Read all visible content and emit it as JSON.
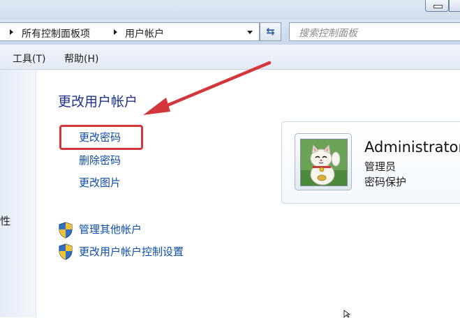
{
  "window": {
    "minimize_icon": "minimize-icon",
    "maximize_icon": "maximize-icon"
  },
  "address_bar": {
    "breadcrumbs": [
      "所有控制面板项",
      "用户帐户"
    ],
    "separator_icon": "chevron-right-icon",
    "dropdown_icon": "chevron-down-icon",
    "refresh_icon": "refresh-icon"
  },
  "search": {
    "placeholder": "搜索控制面板",
    "icon": "search-icon"
  },
  "menu": {
    "items": [
      "工具(T)",
      "帮助(H)"
    ]
  },
  "sidebar": {
    "partial_text": "性"
  },
  "main": {
    "title": "更改用户帐户",
    "tasks": [
      "更改密码",
      "删除密码",
      "更改图片"
    ],
    "admin_tasks": [
      "管理其他帐户",
      "更改用户帐户控制设置"
    ],
    "admin_task_icon": "shield-icon"
  },
  "account": {
    "name": "Administrator",
    "role": "管理员",
    "status": "密码保护",
    "avatar_icon": "lucky-cat-avatar-icon"
  },
  "annotation": {
    "arrow_color": "#d3363b",
    "highlight_color": "#d3363b"
  },
  "colors": {
    "link": "#0c4da6",
    "title": "#1e3287",
    "chrome": "#cfdcec"
  }
}
